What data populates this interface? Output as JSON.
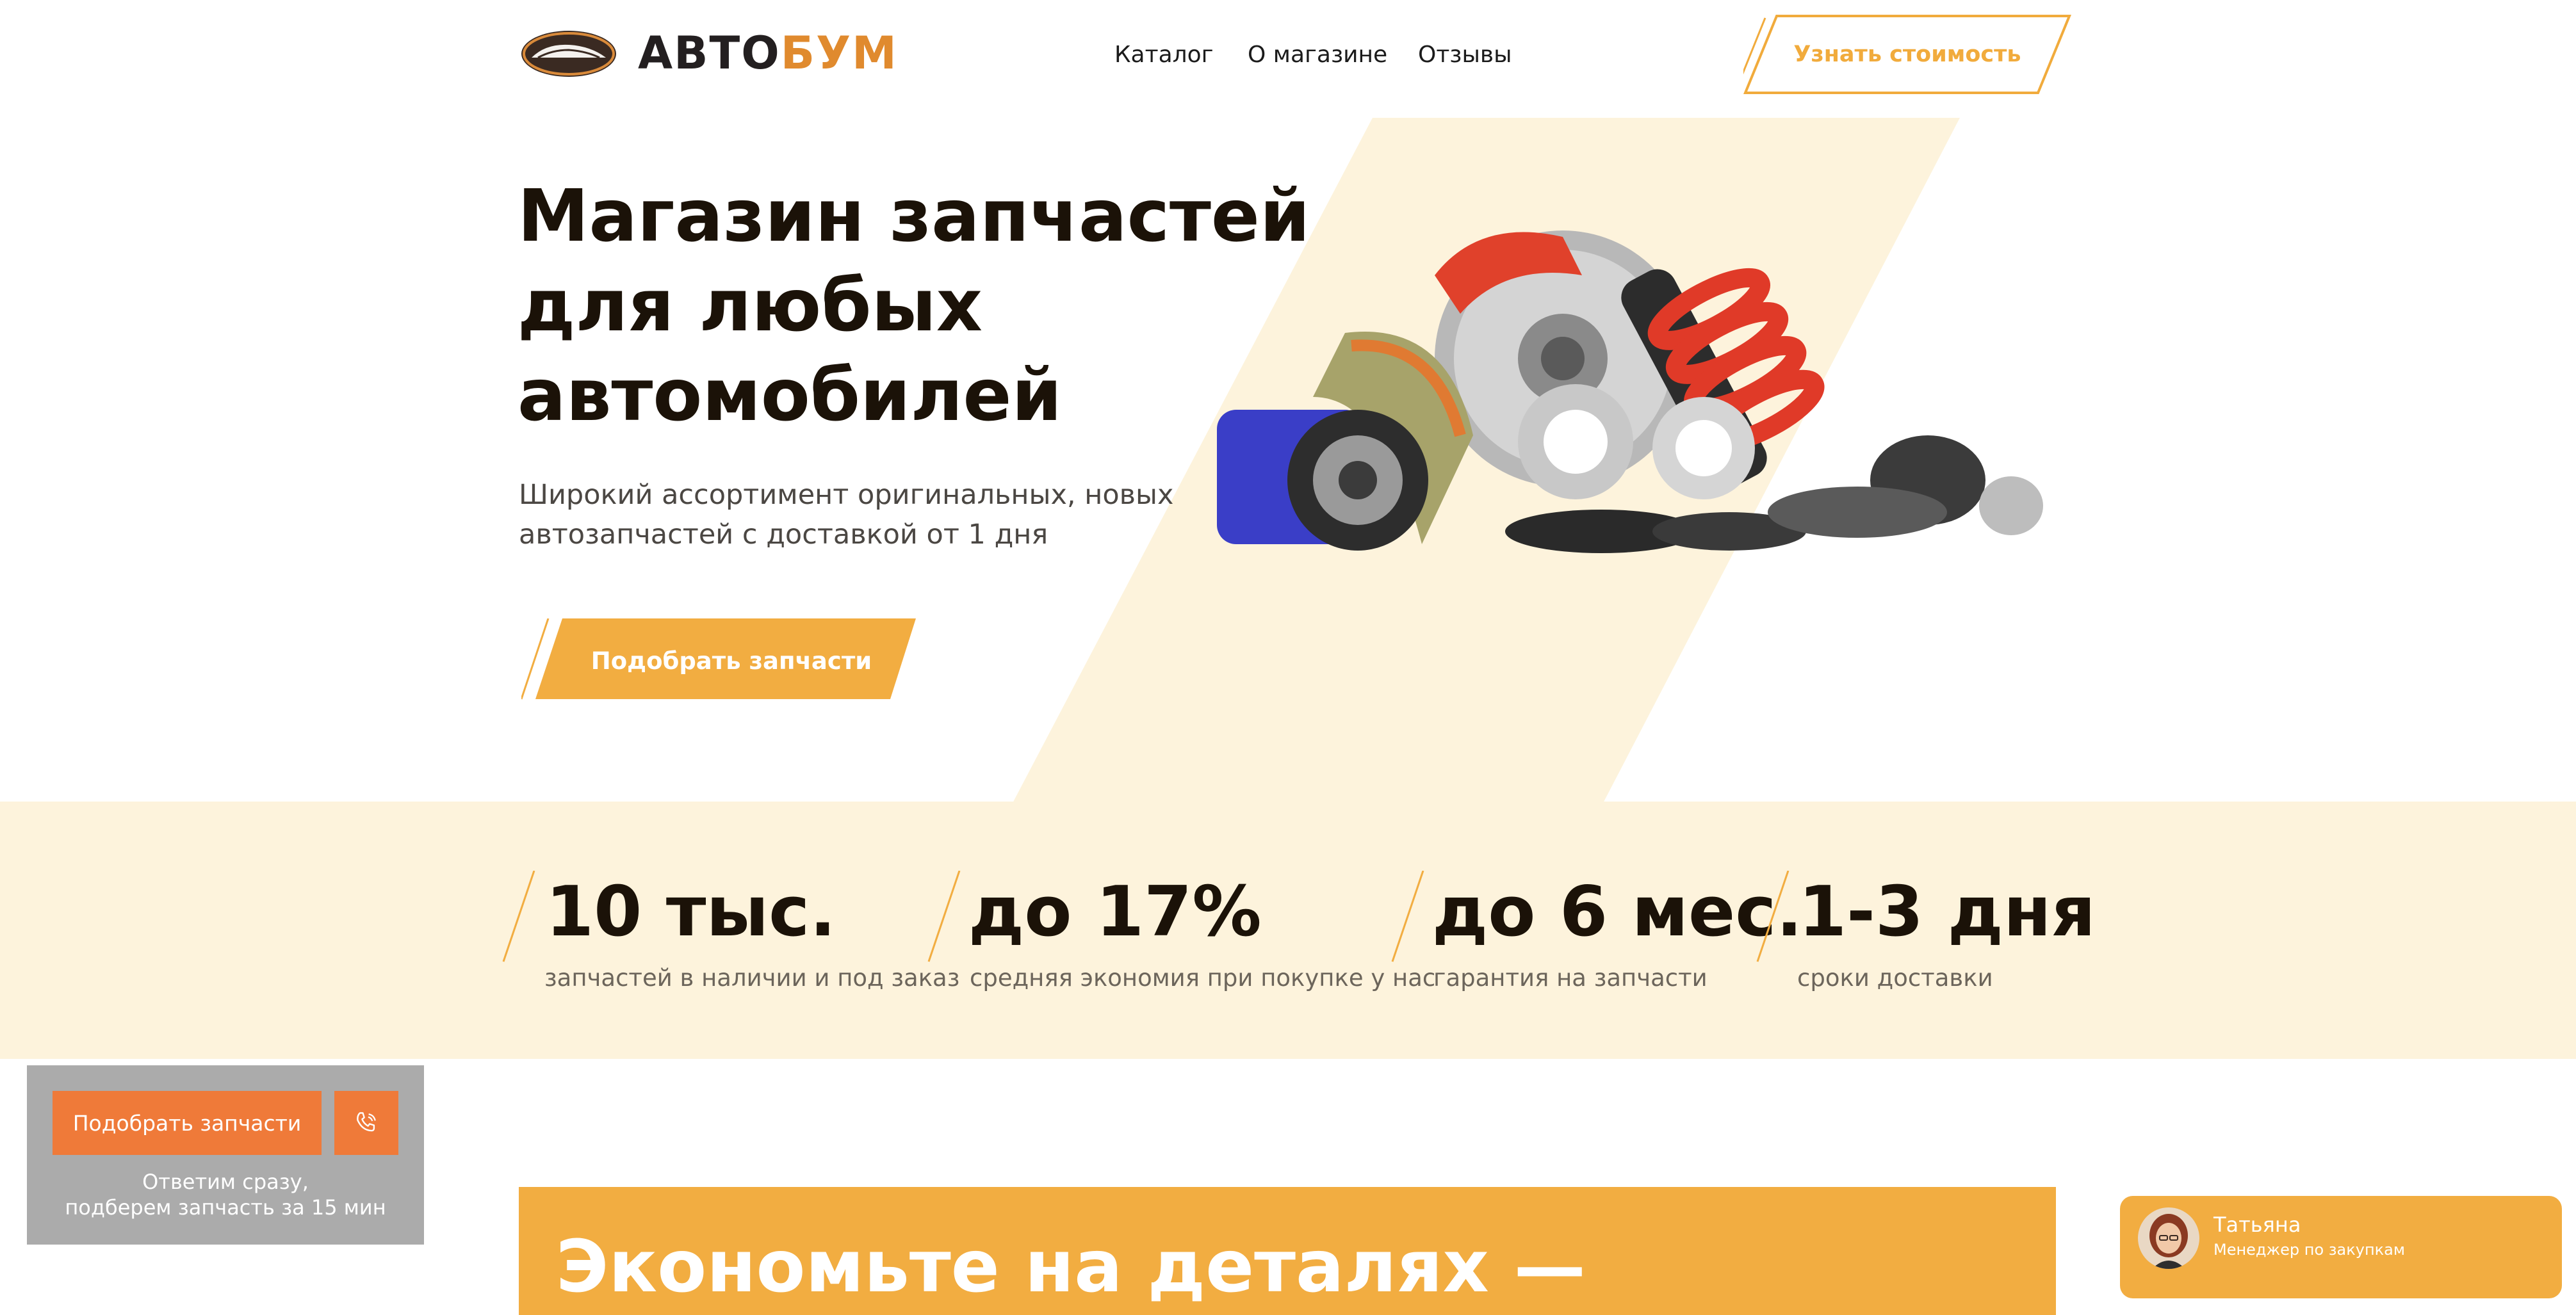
{
  "header": {
    "logo": {
      "part1": "АВТО",
      "part2": "БУМ"
    },
    "nav": [
      "Каталог",
      "О магазине",
      "Отзывы"
    ],
    "cta_label": "Узнать стоимость"
  },
  "hero": {
    "title_lines": [
      "Магазин запчастей",
      "для любых",
      "автомобилей"
    ],
    "subtitle_lines": [
      "Широкий ассортимент оригинальных, новых",
      "автозапчастей с доставкой от 1 дня"
    ],
    "button_label": "Подобрать запчасти"
  },
  "stats": [
    {
      "value": "10 тыс.",
      "label": "запчастей в наличии и под заказ"
    },
    {
      "value": "до 17%",
      "label": "средняя экономия при покупке у нас"
    },
    {
      "value": "до 6 мес.",
      "label": "гарантия на запчасти"
    },
    {
      "value": "1-3 дня",
      "label": "сроки доставки"
    }
  ],
  "widget": {
    "button_label": "Подобрать запчасти",
    "note_lines": [
      "Ответим сразу,",
      "подберем запчасть за 15 мин"
    ]
  },
  "banner": {
    "title": "Экономьте на деталях —"
  },
  "chat": {
    "name": "Татьяна",
    "role": "Менеджер по закупкам"
  },
  "colors": {
    "accent": "#f2ad41",
    "orange": "#ef7a39",
    "cream": "#fdf3dc",
    "dark": "#1b1208"
  }
}
